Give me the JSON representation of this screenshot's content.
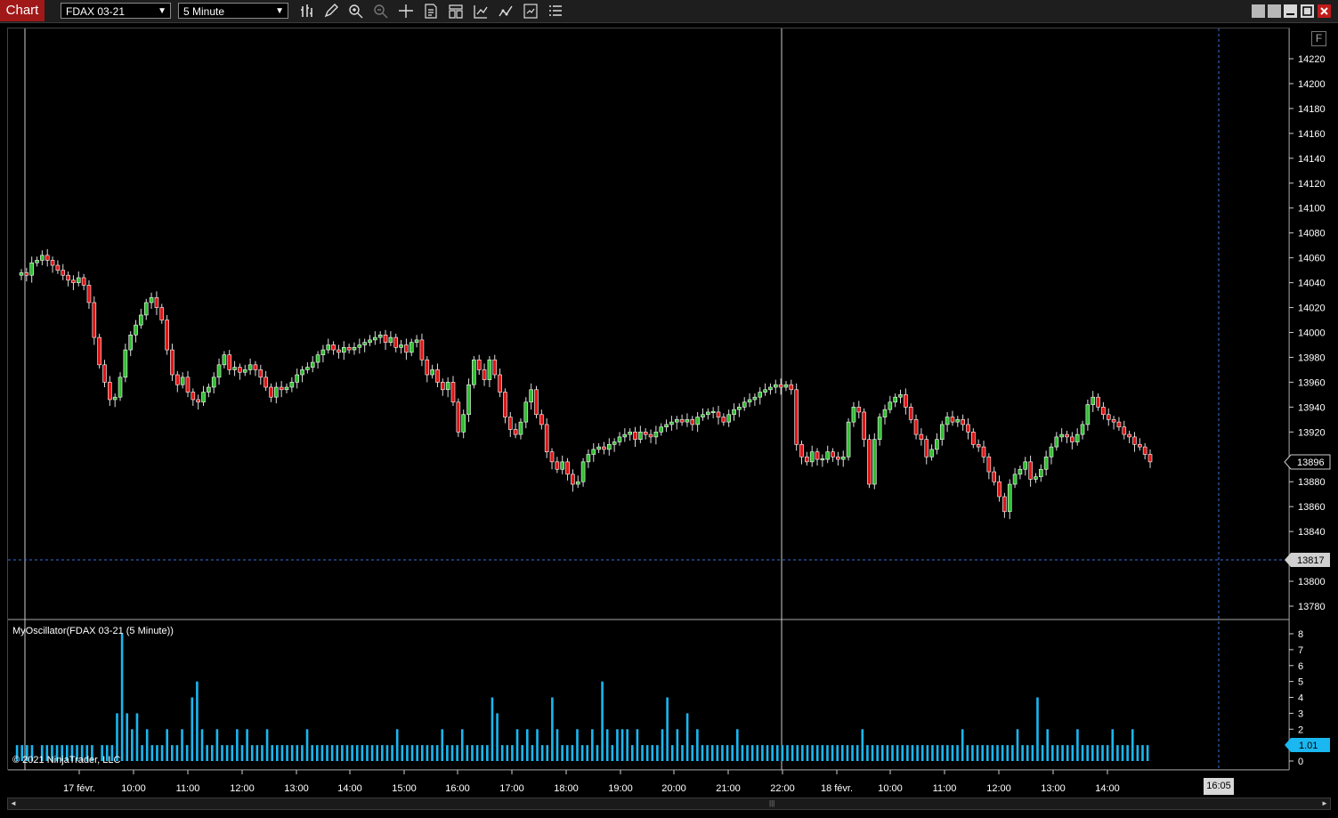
{
  "toolbar": {
    "chart_tab": "Chart",
    "instrument": "FDAX 03-21",
    "interval": "5 Minute",
    "tools": [
      "bar-type-icon",
      "pencil-icon",
      "zoom-in-icon",
      "zoom-out-icon",
      "crosshair-icon",
      "properties-icon",
      "templates-icon",
      "indicators-icon",
      "strategies-icon",
      "data-box-icon",
      "menu-icon"
    ]
  },
  "window": {
    "buttons": [
      "restore-icon",
      "tile-icon",
      "minimize-icon",
      "maximize-icon",
      "close-icon"
    ]
  },
  "price_panel": {
    "y_ticks": [
      "14220",
      "14200",
      "14180",
      "14160",
      "14140",
      "14120",
      "14100",
      "14080",
      "14060",
      "14040",
      "14020",
      "14000",
      "13980",
      "13960",
      "13940",
      "13920",
      "13900",
      "13880",
      "13860",
      "13840",
      "13820",
      "13800",
      "13780"
    ],
    "last_price": "13896",
    "crosshair_price": "13817",
    "f_button": "F"
  },
  "oscillator_panel": {
    "title": "MyOscillator(FDAX 03-21 (5 Minute))",
    "y_ticks": [
      "8",
      "7",
      "6",
      "5",
      "4",
      "3",
      "2",
      "1",
      "0"
    ],
    "current_value": "1.01",
    "copyright": "© 2021 NinjaTrader, LLC"
  },
  "x_axis": {
    "labels": [
      "17 févr.",
      "10:00",
      "11:00",
      "12:00",
      "13:00",
      "14:00",
      "15:00",
      "16:00",
      "17:00",
      "18:00",
      "19:00",
      "20:00",
      "21:00",
      "22:00",
      "18 févr.",
      "10:00",
      "11:00",
      "12:00",
      "13:00",
      "14:00"
    ],
    "crosshair_time": "16:05"
  },
  "colors": {
    "up": "#2fbf2f",
    "down": "#e01414",
    "osc": "#1ab7f0",
    "accent": "#a01818"
  },
  "chart_data": [
    {
      "type": "candlestick",
      "ylim": [
        13768,
        14232
      ],
      "close_series": [
        14048,
        14046,
        14056,
        14058,
        14062,
        14058,
        14054,
        14050,
        14046,
        14042,
        14040,
        14044,
        14038,
        14024,
        13996,
        13974,
        13960,
        13946,
        13948,
        13964,
        13986,
        13998,
        14006,
        14014,
        14024,
        14028,
        14020,
        14010,
        13986,
        13966,
        13958,
        13964,
        13952,
        13946,
        13944,
        13952,
        13956,
        13964,
        13974,
        13982,
        13970,
        13972,
        13968,
        13970,
        13974,
        13970,
        13964,
        13956,
        13948,
        13956,
        13954,
        13956,
        13960,
        13966,
        13970,
        13972,
        13976,
        13982,
        13986,
        13990,
        13986,
        13984,
        13988,
        13986,
        13988,
        13990,
        13992,
        13994,
        13996,
        13998,
        13992,
        13996,
        13988,
        13990,
        13984,
        13992,
        13994,
        13978,
        13966,
        13970,
        13960,
        13954,
        13960,
        13944,
        13920,
        13934,
        13958,
        13978,
        13970,
        13962,
        13978,
        13966,
        13952,
        13932,
        13922,
        13918,
        13928,
        13944,
        13954,
        13934,
        13926,
        13904,
        13896,
        13890,
        13896,
        13886,
        13878,
        13880,
        13896,
        13902,
        13906,
        13908,
        13906,
        13910,
        13912,
        13916,
        13918,
        13920,
        13914,
        13920,
        13918,
        13916,
        13920,
        13924,
        13926,
        13928,
        13930,
        13928,
        13930,
        13926,
        13932,
        13934,
        13936,
        13936,
        13932,
        13928,
        13934,
        13938,
        13940,
        13944,
        13946,
        13948,
        13952,
        13954,
        13956,
        13958,
        13956,
        13958,
        13954,
        13910,
        13900,
        13896,
        13904,
        13898,
        13898,
        13904,
        13900,
        13898,
        13900,
        13928,
        13940,
        13936,
        13914,
        13878,
        13914,
        13932,
        13938,
        13944,
        13948,
        13950,
        13940,
        13930,
        13918,
        13914,
        13900,
        13906,
        13914,
        13926,
        13932,
        13928,
        13930,
        13926,
        13920,
        13910,
        13908,
        13900,
        13888,
        13880,
        13868,
        13856,
        13878,
        13886,
        13890,
        13896,
        13882,
        13884,
        13890,
        13900,
        13908,
        13916,
        13918,
        13916,
        13912,
        13918,
        13926,
        13942,
        13948,
        13940,
        13934,
        13930,
        13928,
        13924,
        13918,
        13916,
        13910,
        13908,
        13902,
        13896
      ],
      "x_labels": [
        "17 févr.",
        "10:00",
        "11:00",
        "12:00",
        "13:00",
        "14:00",
        "15:00",
        "16:00",
        "17:00",
        "18:00",
        "19:00",
        "20:00",
        "21:00",
        "22:00",
        "18 févr.",
        "10:00",
        "11:00",
        "12:00",
        "13:00",
        "14:00"
      ]
    },
    {
      "type": "bar",
      "title": "MyOscillator(FDAX 03-21 (5 Minute))",
      "ylim": [
        0,
        8.5
      ],
      "values": [
        1,
        1,
        1,
        1,
        0,
        1,
        1,
        1,
        1,
        1,
        1,
        1,
        1,
        1,
        1,
        1,
        0,
        1,
        1,
        1,
        3,
        8,
        3,
        2,
        3,
        1,
        2,
        1,
        1,
        1,
        2,
        1,
        1,
        2,
        1,
        4,
        5,
        2,
        1,
        1,
        2,
        1,
        1,
        1,
        2,
        1,
        2,
        1,
        1,
        1,
        2,
        1,
        1,
        1,
        1,
        1,
        1,
        1,
        2,
        1,
        1,
        1,
        1,
        1,
        1,
        1,
        1,
        1,
        1,
        1,
        1,
        1,
        1,
        1,
        1,
        1,
        2,
        1,
        1,
        1,
        1,
        1,
        1,
        1,
        1,
        2,
        1,
        1,
        1,
        2,
        1,
        1,
        1,
        1,
        1,
        4,
        3,
        1,
        1,
        1,
        2,
        1,
        2,
        1,
        2,
        1,
        1,
        4,
        2,
        1,
        1,
        1,
        2,
        1,
        1,
        2,
        1,
        5,
        2,
        1,
        2,
        2,
        2,
        1,
        2,
        1,
        1,
        1,
        1,
        2,
        4,
        1,
        2,
        1,
        3,
        1,
        2,
        1,
        1,
        1,
        1,
        1,
        1,
        1,
        2,
        1,
        1,
        1,
        1,
        1,
        1,
        1,
        1,
        1,
        1,
        1,
        1,
        1,
        1,
        1,
        1,
        1,
        1,
        1,
        1,
        1,
        1,
        1,
        1,
        2,
        1,
        1,
        1,
        1,
        1,
        1,
        1,
        1,
        1,
        1,
        1,
        1,
        1,
        1,
        1,
        1,
        1,
        1,
        1,
        2,
        1,
        1,
        1,
        1,
        1,
        1,
        1,
        1,
        1,
        1,
        2,
        1,
        1,
        1,
        4,
        1,
        2,
        1,
        1,
        1,
        1,
        1,
        2,
        1,
        1,
        1,
        1,
        1,
        1,
        2,
        1,
        1,
        1,
        2,
        1,
        1,
        1
      ],
      "current_value": 1.01
    }
  ]
}
